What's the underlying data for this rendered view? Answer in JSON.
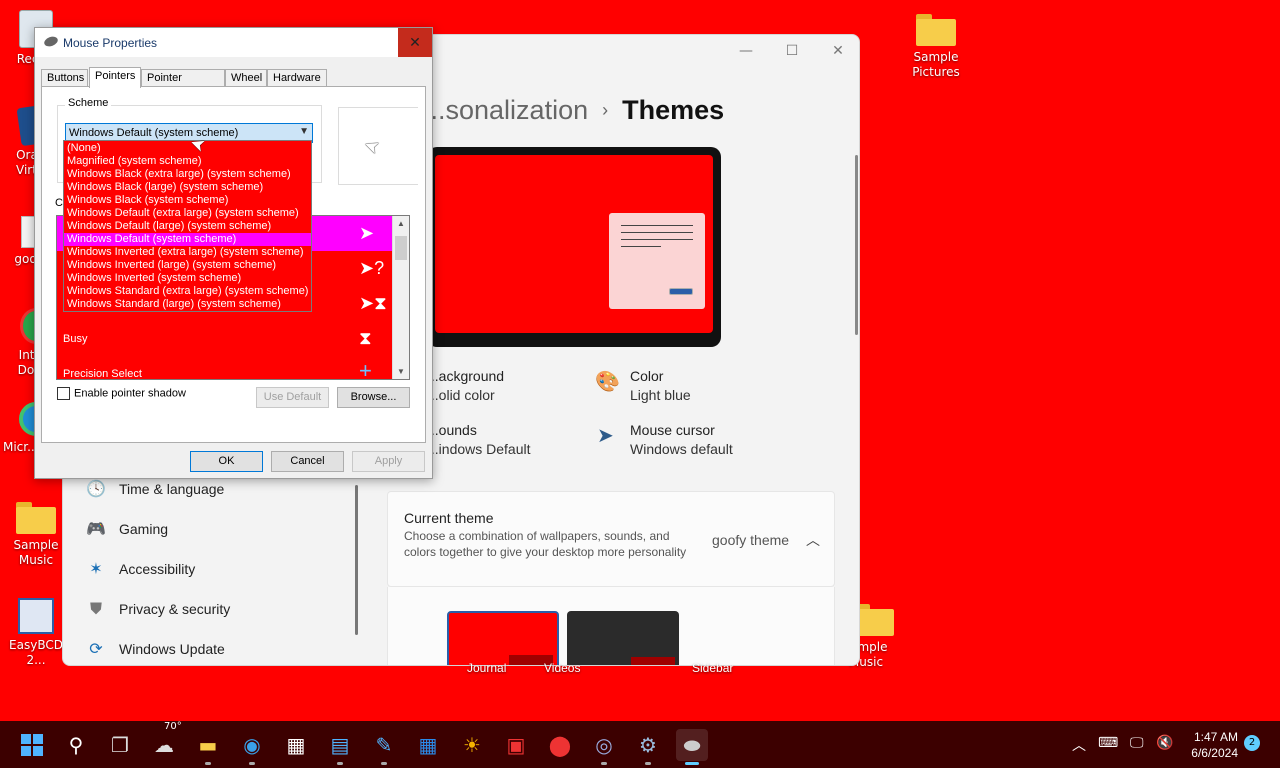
{
  "desktop": {
    "icons": [
      {
        "label": "Recy..."
      },
      {
        "label": "Orac... Virtu..."
      },
      {
        "label": "goofy..."
      },
      {
        "label": "Inte... Dow..."
      },
      {
        "label": "Micr... Ed..."
      },
      {
        "label": "Sample Music"
      },
      {
        "label": "EasyBCD 2..."
      },
      {
        "label": "Sample Pictures"
      },
      {
        "label": "...mple Music"
      }
    ],
    "under_labels": [
      "Journal",
      "Videos",
      "Sidebar"
    ]
  },
  "settings": {
    "breadcrumb_parent": "...sonalization",
    "breadcrumb_sep": "›",
    "page_title": "Themes",
    "props": {
      "background": {
        "label": "...ackground",
        "value": "...olid color"
      },
      "color": {
        "label": "Color",
        "value": "Light blue"
      },
      "sounds": {
        "label": "...ounds",
        "value": "...indows Default"
      },
      "mouse_cursor": {
        "label": "Mouse cursor",
        "value": "Windows default"
      }
    },
    "nav": [
      {
        "label": "Time & language"
      },
      {
        "label": "Gaming"
      },
      {
        "label": "Accessibility"
      },
      {
        "label": "Privacy & security"
      },
      {
        "label": "Windows Update"
      }
    ],
    "current_theme": {
      "title": "Current theme",
      "desc": "Choose a combination of wallpapers, sounds, and colors together to give your desktop more personality",
      "value": "goofy theme"
    }
  },
  "dialog": {
    "title": "Mouse Properties",
    "close": "✕",
    "tabs": [
      "Buttons",
      "Pointers",
      "Pointer Options",
      "Wheel",
      "Hardware"
    ],
    "active_tab": "Pointers",
    "scheme_label": "Scheme",
    "scheme_value": "Windows Default (system scheme)",
    "customize_label": "Cu...",
    "scheme_options": [
      "(None)",
      "Magnified (system scheme)",
      "Windows Black (extra large) (system scheme)",
      "Windows Black (large) (system scheme)",
      "Windows Black (system scheme)",
      "Windows Default (extra large) (system scheme)",
      "Windows Default (large) (system scheme)",
      "Windows Default (system scheme)",
      "Windows Inverted (extra large) (system scheme)",
      "Windows Inverted (large) (system scheme)",
      "Windows Inverted (system scheme)",
      "Windows Standard (extra large) (system scheme)",
      "Windows Standard (large) (system scheme)"
    ],
    "selected_option_index": 7,
    "pointer_rows": [
      {
        "label": "",
        "icon": "arrow-cursor-icon"
      },
      {
        "label": "",
        "icon": "help-cursor-icon"
      },
      {
        "label": "",
        "icon": "working-cursor-icon"
      },
      {
        "label": "Busy",
        "icon": "hourglass-icon"
      },
      {
        "label": "Precision Select",
        "icon": "crosshair-icon"
      }
    ],
    "shadow_label": "Enable pointer shadow",
    "use_default": "Use Default",
    "browse": "Browse...",
    "ok": "OK",
    "cancel": "Cancel",
    "apply": "Apply"
  },
  "taskbar": {
    "weather_temp": "70°",
    "time": "1:47 AM",
    "date": "6/6/2024",
    "notifications": "2"
  }
}
